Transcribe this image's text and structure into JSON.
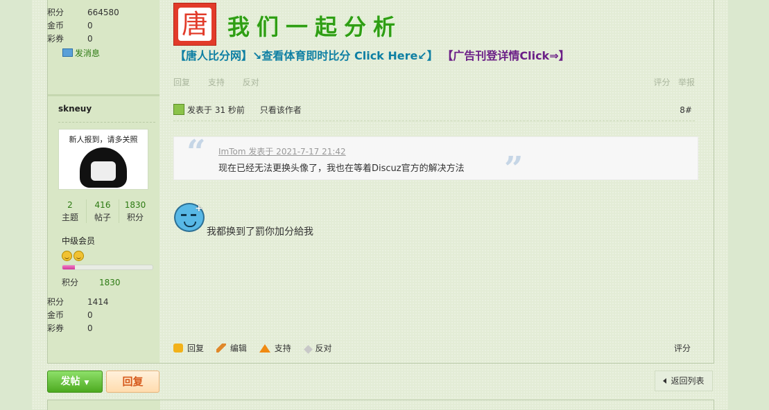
{
  "prev_user": {
    "stats": [
      {
        "label": "积分",
        "value": "664580"
      },
      {
        "label": "金币",
        "value": "0"
      },
      {
        "label": "彩券",
        "value": "0"
      }
    ],
    "pm_label": "发消息"
  },
  "user": {
    "name": "skneuy",
    "avatar_caption": "新人报到，请多关照",
    "counts": [
      {
        "num": "2",
        "label": "主题"
      },
      {
        "num": "416",
        "label": "帖子"
      },
      {
        "num": "1830",
        "label": "积分"
      }
    ],
    "rank": "中级会员",
    "progress_fraction": 0.14,
    "credit_label": "积分",
    "credit_value": "1830",
    "stats": [
      {
        "label": "积分",
        "value": "1414"
      },
      {
        "label": "金币",
        "value": "0"
      },
      {
        "label": "彩券",
        "value": "0"
      }
    ]
  },
  "banner": {
    "logo_char": "唐",
    "slogan": "我们一起分析",
    "ad_left": "【唐人比分网】↘查看体育即时比分 Click Here↙】",
    "ad_right": "【广告刊登详情Click⇒】"
  },
  "prev_actions": {
    "reply": "回复",
    "support": "支持",
    "oppose": "反对",
    "rate": "评分",
    "report": "举报"
  },
  "post": {
    "posted": "发表于 31 秒前",
    "author_only": "只看该作者",
    "floor": "8#",
    "quote_head": "ImTom 发表于 2021-7-17 21:42",
    "quote_text": "现在已经无法更换头像了，我也在等着Discuz官方的解决方法",
    "body": "我都换到了罰你加分給我",
    "actions": {
      "reply": "回复",
      "edit": "编辑",
      "support": "支持",
      "oppose": "反对",
      "rate": "评分"
    }
  },
  "buttons": {
    "new_post": "发帖",
    "reply": "回复",
    "back": "返回列表"
  },
  "colors": {
    "accent_green": "#2c7a12",
    "banner_ad_teal": "#0e7fa3",
    "banner_ad_purple": "#6b1f87",
    "progress_pink": "#d0389a"
  }
}
